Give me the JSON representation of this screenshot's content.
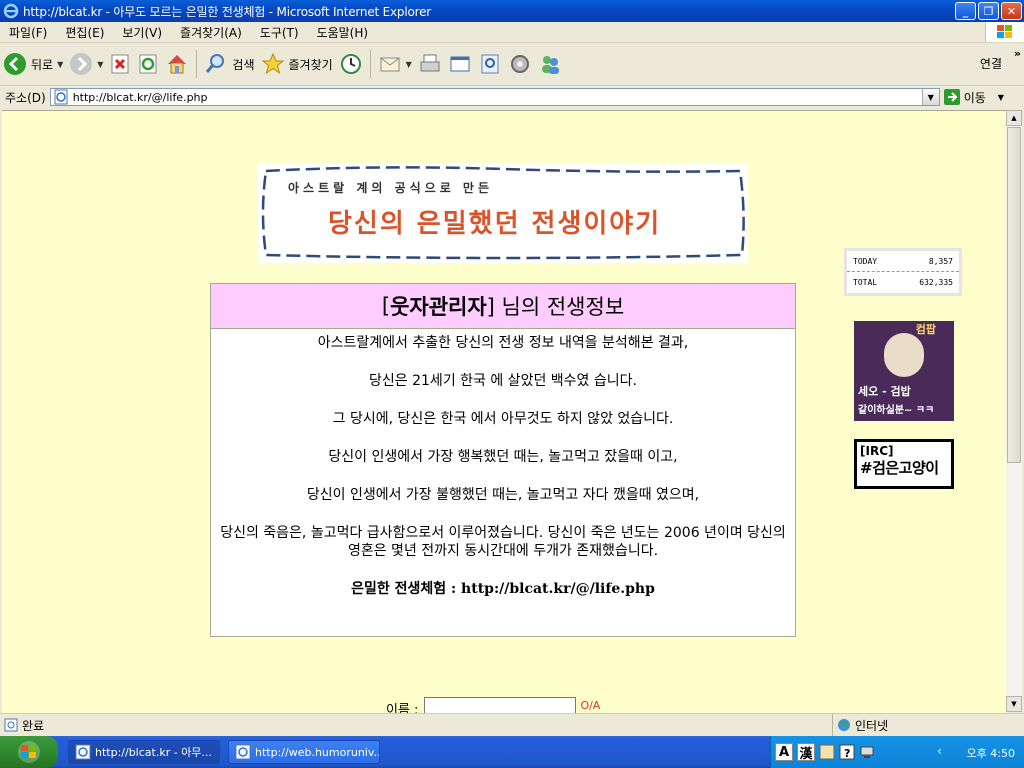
{
  "window": {
    "title": "http://blcat.kr - 아무도 모르는 은밀한 전생체험 - Microsoft Internet Explorer",
    "min_glyph": "_",
    "max_glyph": "❐",
    "close_glyph": "✕"
  },
  "menubar": {
    "items": [
      "파일(F)",
      "편집(E)",
      "보기(V)",
      "즐겨찾기(A)",
      "도구(T)",
      "도움말(H)"
    ]
  },
  "toolbar": {
    "back_label": "뒤로",
    "search_label": "검색",
    "favorites_label": "즐겨찾기",
    "links_label": "연결",
    "links_chevron": "»"
  },
  "address_bar": {
    "label": "주소(D)",
    "url": "http://blcat.kr/@/life.php",
    "go_label": "이동"
  },
  "page": {
    "banner": {
      "small_text": "아스트랄 계의 공식으로 만든",
      "big_text": "당신의 은밀했던 전생이야기"
    },
    "info": {
      "head_open": "[ ",
      "user_name": "웃자관리자",
      "head_close": " ] 님의 전생정보",
      "lines": [
        "아스트랄계에서 추출한 당신의 전생 정보 내역을 분석해본 결과,",
        "당신은 21세기 한국 에 살았던 백수였 습니다.",
        "그 당시에, 당신은 한국 에서 아무것도 하지 않았 었습니다.",
        "당신이 인생에서 가장 행복했던 때는, 놀고먹고 잤을때 이고,",
        "당신이 인생에서 가장 불행했던 때는, 놀고먹고 자다 깼을때 였으며,",
        "당신의 죽음은, 놀고먹다 급사함으로서 이루어졌습니다. 당신이 죽은 년도는 2006 년이며 당신의 영혼은 몇년 전까지 동시간대에 두개가 존재했습니다."
      ],
      "footer_label": "은밀한 전생체험",
      "footer_url": " : http://blcat.kr/@/life.php"
    },
    "counter": {
      "today_label": "TODAY",
      "today_value": "8,357",
      "total_label": "TOTAL",
      "total_value": "632,335"
    },
    "ad": {
      "top_text": "컴팝",
      "line1": "세오 - 검밥",
      "line2": "같이하실분~ ㅋㅋ"
    },
    "irc": {
      "tag": "[IRC]",
      "channel": "#검은고양이"
    },
    "name_label": "이름 :",
    "name_hint": "O/A"
  },
  "statusbar": {
    "status_text": "완료",
    "zone_text": "인터넷"
  },
  "taskbar": {
    "tasks": [
      "http://blcat.kr - 아무...",
      "http://web.humoruniv..."
    ],
    "ime_a": "A",
    "ime_han": "漢",
    "clock": "오후 4:50",
    "chevron": "‹"
  },
  "colors": {
    "page_bg": "#ffffcc",
    "header_bg": "#ffccff",
    "banner_text": "#d9542a",
    "titlebar_blue": "#0548c4"
  }
}
